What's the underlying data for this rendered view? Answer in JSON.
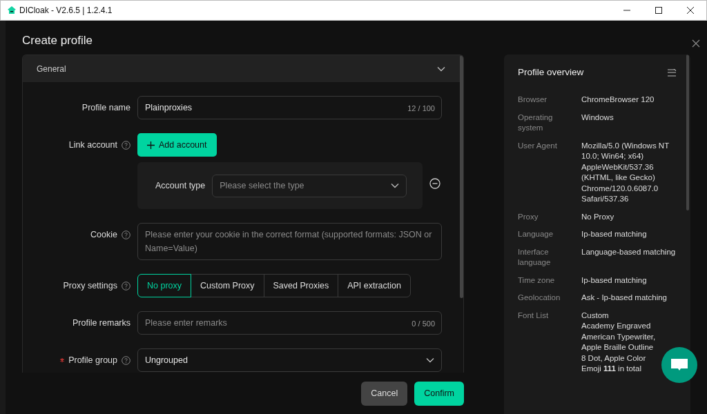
{
  "window": {
    "title": "DICloak - V2.6.5 | 1.2.4.1"
  },
  "dialog": {
    "title": "Create profile"
  },
  "section": {
    "title": "General",
    "expanded": true
  },
  "fields": [
    {
      "kind": "text",
      "label": "Profile name",
      "help": false,
      "required": false,
      "value": "Plainproxies",
      "counter": "12 / 100"
    },
    {
      "kind": "account",
      "label": "Link account",
      "help": true,
      "required": false,
      "button": "Add account",
      "sub_label": "Account type",
      "placeholder": "Please select the type"
    },
    {
      "kind": "textarea",
      "label": "Cookie",
      "help": true,
      "required": false,
      "placeholder": "Please enter your cookie in the correct format (supported formats: JSON or Name=Value)"
    },
    {
      "kind": "segmented",
      "label": "Proxy settings",
      "help": true,
      "required": false,
      "options": [
        {
          "label": "No proxy",
          "selected": true
        },
        {
          "label": "Custom Proxy",
          "selected": false
        },
        {
          "label": "Saved Proxies",
          "selected": false
        },
        {
          "label": "API extraction",
          "selected": false
        }
      ]
    },
    {
      "kind": "text",
      "label": "Profile remarks",
      "help": false,
      "required": false,
      "placeholder": "Please enter remarks",
      "counter": "0 / 500"
    },
    {
      "kind": "select",
      "label": "Profile group",
      "help": true,
      "required": true,
      "value": "Ungrouped"
    }
  ],
  "footer_buttons": [
    {
      "label": "Cancel",
      "kind": "secondary"
    },
    {
      "label": "Confirm",
      "kind": "primary"
    }
  ],
  "overview": {
    "title": "Profile overview",
    "rows": [
      {
        "label": "Browser",
        "value": "ChromeBrowser 120"
      },
      {
        "label": "Operating system",
        "value": "Windows"
      },
      {
        "label": "User Agent",
        "value": "Mozilla/5.0 (Windows NT 10.0; Win64; x64) AppleWebKit/537.36 (KHTML, like Gecko) Chrome/120.0.6087.0 Safari/537.36"
      },
      {
        "label": "Proxy",
        "value": "No Proxy"
      },
      {
        "label": "Language",
        "value": "Ip-based matching"
      },
      {
        "label": "Interface language",
        "value": "Language-based matching"
      },
      {
        "label": "Time zone",
        "value": "Ip-based matching"
      },
      {
        "label": "Geolocation",
        "value": "Ask - Ip-based matching"
      },
      {
        "label": "Font List",
        "value": "Custom",
        "details": [
          "Academy Engraved",
          "American Typewriter, Apple Braille Outline 8 Dot, Apple Color Emoji **111** in total"
        ]
      }
    ]
  }
}
